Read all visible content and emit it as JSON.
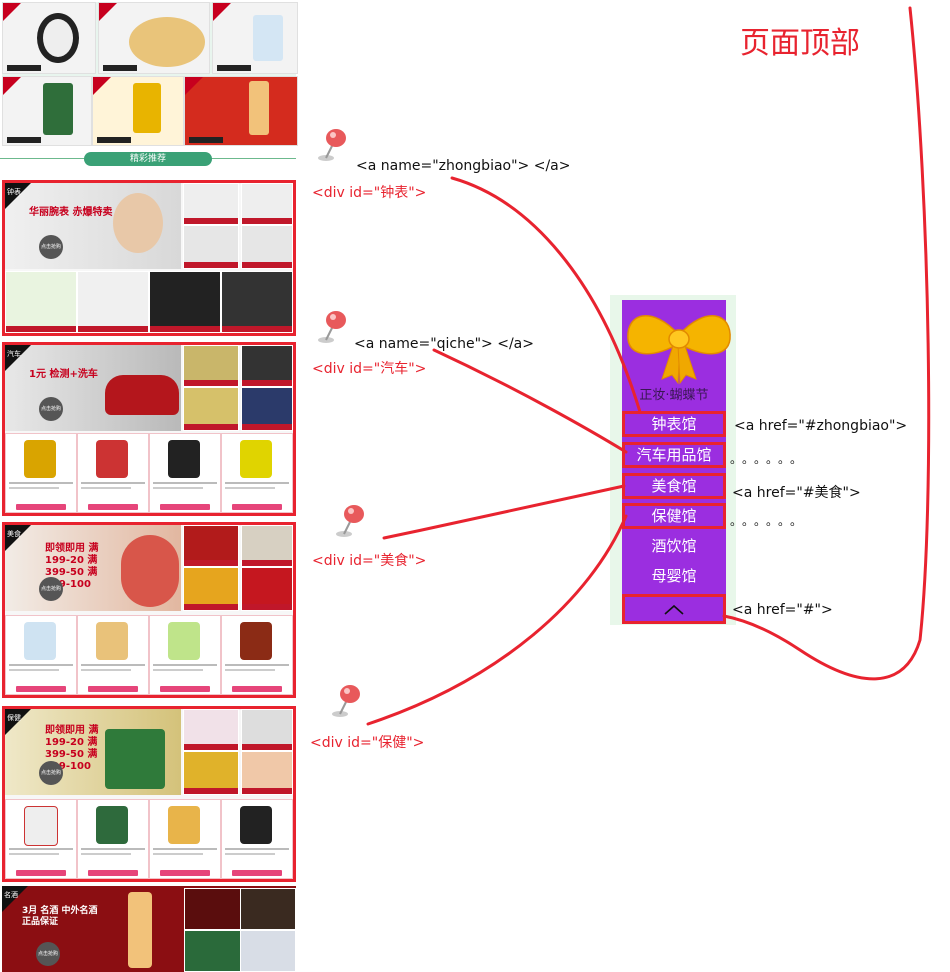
{
  "page_title": "页面顶部",
  "recommend_label": "精彩推荐",
  "anchors": {
    "zhongbiao": "<a name=\"zhongbiao\"> </a>",
    "qiche": "<a name=\"qiche\"> </a>"
  },
  "divs": {
    "watch": "<div id=\"钟表\">",
    "car": "<div id=\"汽车\">",
    "food": "<div id=\"美食\">",
    "health": "<div id=\"保健\">"
  },
  "links": {
    "zhongbiao": "<a href=\"#zhongbiao\">",
    "food": "<a href=\"#美食\">",
    "top": "<a href=\"#\">",
    "dots1": "。。。。。。",
    "dots2": "。。。。。。"
  },
  "nav": {
    "caption": "正妆·蝴蝶节",
    "items": [
      "钟表馆",
      "汽车用品馆",
      "美食馆",
      "保健馆",
      "酒饮馆",
      "母婴馆"
    ],
    "up_icon": "chevron-up-icon"
  },
  "sections": {
    "watch": {
      "tag": "钟表",
      "headline": "华丽腕表 赤爆特卖",
      "button": "点击抢购"
    },
    "car": {
      "tag": "汽车",
      "headline": "1元 检测+洗车",
      "button": "点击抢购"
    },
    "food": {
      "tag": "美食",
      "headline": "即领即用 满199-20 满399-50 满599-100",
      "button": "点击抢购"
    },
    "health": {
      "tag": "保健",
      "headline": "即领即用 满199-20 满399-50 满599-100",
      "button": "点击抢购"
    },
    "wine": {
      "tag": "名酒",
      "headline": "3月 名酒 中外名酒 正品保证",
      "button": "点击抢购"
    }
  },
  "colors": {
    "annotation_red": "#e8232f",
    "nav_purple": "#9b2ee0",
    "nav_bg": "#e8f7ea",
    "bow_gold": "#f5b400"
  }
}
